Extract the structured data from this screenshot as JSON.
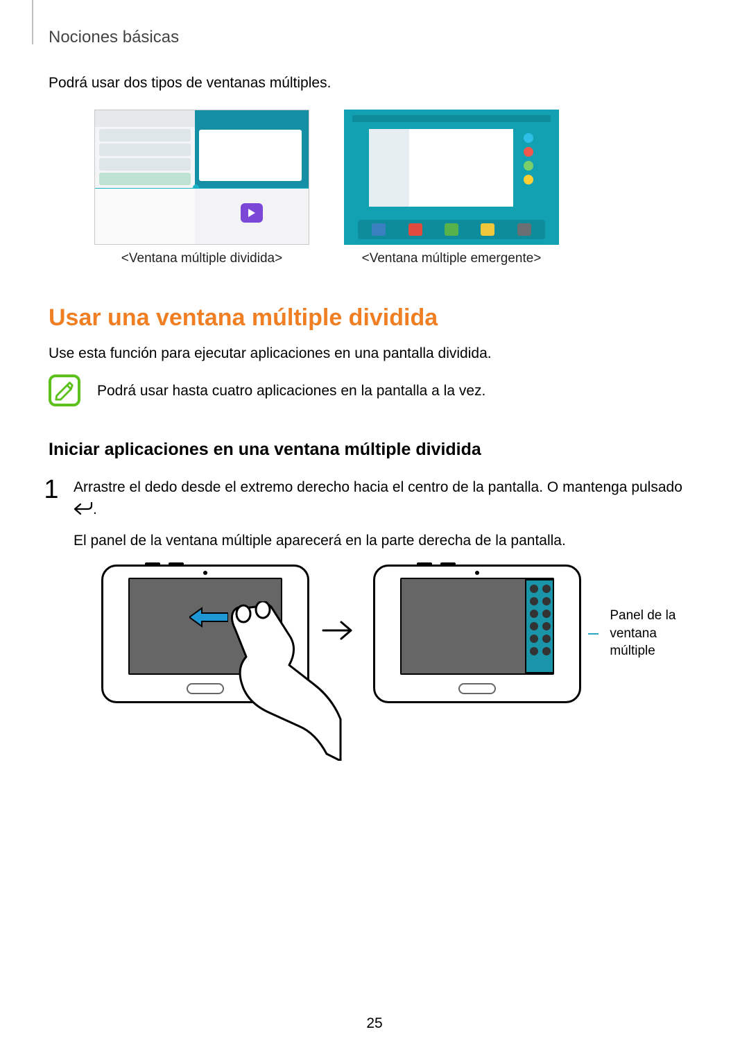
{
  "breadcrumb": "Nociones básicas",
  "intro": "Podrá usar dos tipos de ventanas múltiples.",
  "captions": {
    "split": "<Ventana múltiple dividida>",
    "popup": "<Ventana múltiple emergente>"
  },
  "section": {
    "heading": "Usar una ventana múltiple dividida",
    "body": "Use esta función para ejecutar aplicaciones en una pantalla dividida."
  },
  "note": "Podrá usar hasta cuatro aplicaciones en la pantalla a la vez.",
  "subheading": "Iniciar aplicaciones en una ventana múltiple dividida",
  "step1": {
    "num": "1",
    "line1_a": "Arrastre el dedo desde el extremo derecho hacia el centro de la pantalla. O mantenga pulsado ",
    "line1_b": ".",
    "line2": "El panel de la ventana múltiple aparecerá en la parte derecha de la pantalla."
  },
  "callout": "Panel de la ventana múltiple",
  "page_number": "25"
}
